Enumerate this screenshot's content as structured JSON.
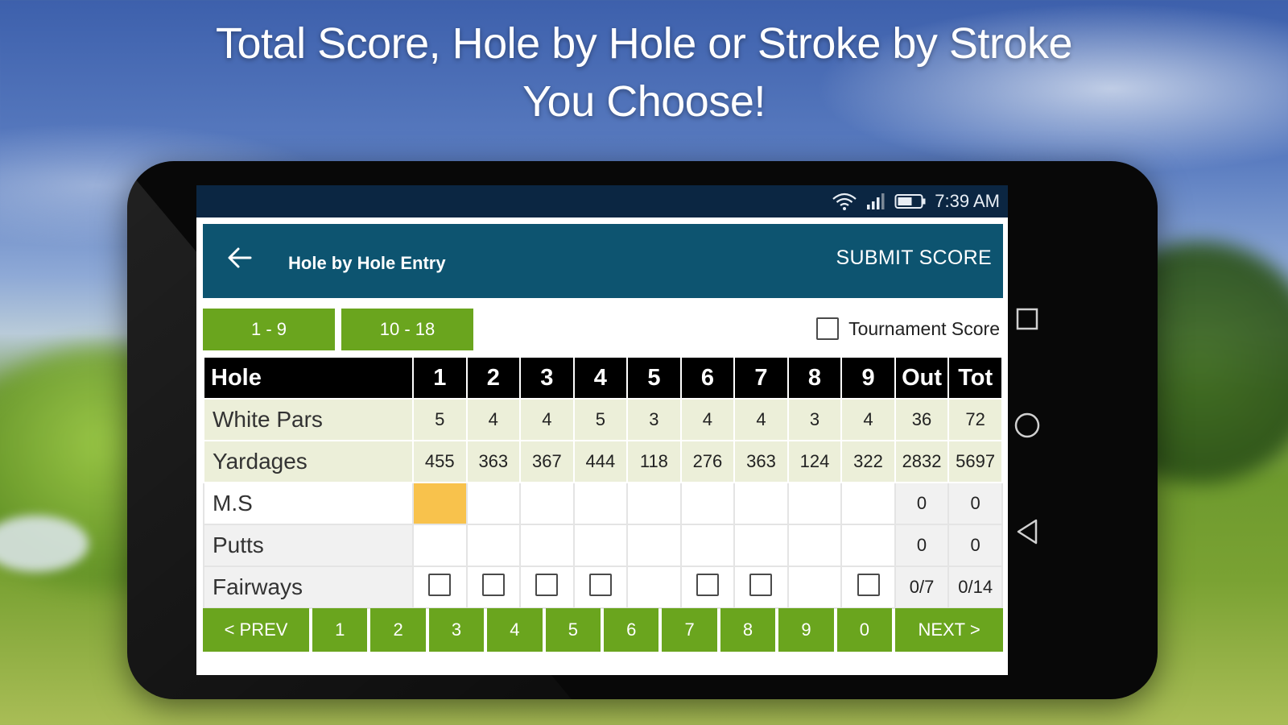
{
  "headline": {
    "line1": "Total Score, Hole by Hole or Stroke by Stroke",
    "line2": "You Choose!"
  },
  "statusbar": {
    "time": "7:39 AM",
    "icons": [
      "wifi-icon",
      "signal-icon",
      "battery-icon"
    ]
  },
  "appbar": {
    "back_icon": "arrow-left-icon",
    "title": "Hole by Hole Entry",
    "submit_label": "SUBMIT SCORE"
  },
  "range_tabs": [
    "1 - 9",
    "10 - 18"
  ],
  "tournament": {
    "label": "Tournament Score",
    "checked": false
  },
  "scorecard": {
    "header": [
      "Hole",
      "1",
      "2",
      "3",
      "4",
      "5",
      "6",
      "7",
      "8",
      "9",
      "Out",
      "Tot"
    ],
    "rows": {
      "pars": {
        "label": "White Pars",
        "values": [
          "5",
          "4",
          "4",
          "5",
          "3",
          "4",
          "4",
          "3",
          "4",
          "36",
          "72"
        ]
      },
      "yardages": {
        "label": "Yardages",
        "values": [
          "455",
          "363",
          "367",
          "444",
          "118",
          "276",
          "363",
          "124",
          "322",
          "2832",
          "5697"
        ]
      },
      "ms": {
        "label": "M.S",
        "values": [
          "",
          "",
          "",
          "",
          "",
          "",
          "",
          "",
          "",
          "0",
          "0"
        ]
      },
      "putts": {
        "label": "Putts",
        "values": [
          "",
          "",
          "",
          "",
          "",
          "",
          "",
          "",
          "",
          "0",
          "0"
        ]
      },
      "fairways": {
        "label": "Fairways",
        "checkboxes": [
          true,
          true,
          true,
          true,
          false,
          true,
          true,
          false,
          true
        ],
        "out": "0/7",
        "tot": "0/14"
      }
    }
  },
  "keypad": [
    "< PREV",
    "1",
    "2",
    "3",
    "4",
    "5",
    "6",
    "7",
    "8",
    "9",
    "0",
    "NEXT >"
  ],
  "device_nav": [
    "recents-square-icon",
    "home-circle-icon",
    "back-triangle-icon"
  ],
  "colors": {
    "appbar": "#0d5470",
    "statusbar": "#0b2642",
    "accent_green": "#6aa51e",
    "active_cell": "#f8c24c"
  }
}
